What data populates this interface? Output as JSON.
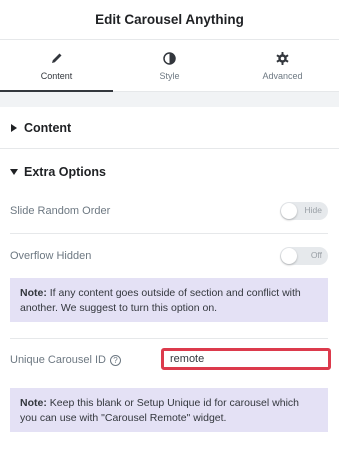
{
  "header": {
    "title": "Edit Carousel Anything"
  },
  "tabs": [
    {
      "label": "Content",
      "icon": "pencil-icon",
      "active": true
    },
    {
      "label": "Style",
      "icon": "half-circle-icon",
      "active": false
    },
    {
      "label": "Advanced",
      "icon": "gear-icon",
      "active": false
    }
  ],
  "sections": {
    "content": {
      "title": "Content",
      "expanded": false
    },
    "extra_options": {
      "title": "Extra Options",
      "expanded": true
    }
  },
  "controls": {
    "slide_random_order": {
      "label": "Slide Random Order",
      "toggle_label": "Hide",
      "value": false
    },
    "overflow_hidden": {
      "label": "Overflow Hidden",
      "toggle_label": "Off",
      "value": false
    },
    "note1": {
      "prefix": "Note:",
      "text": " If any content goes outside of section and conflict with another. We suggest to turn this option on."
    },
    "unique_id": {
      "label": "Unique Carousel ID",
      "value": "remote"
    },
    "note2": {
      "prefix": "Note:",
      "text": " Keep this blank or Setup Unique id for carousel which you can use with \"Carousel Remote\" widget."
    }
  },
  "colors": {
    "note_bg": "#e4e1f5",
    "input_highlight": "#dc3a4c"
  }
}
